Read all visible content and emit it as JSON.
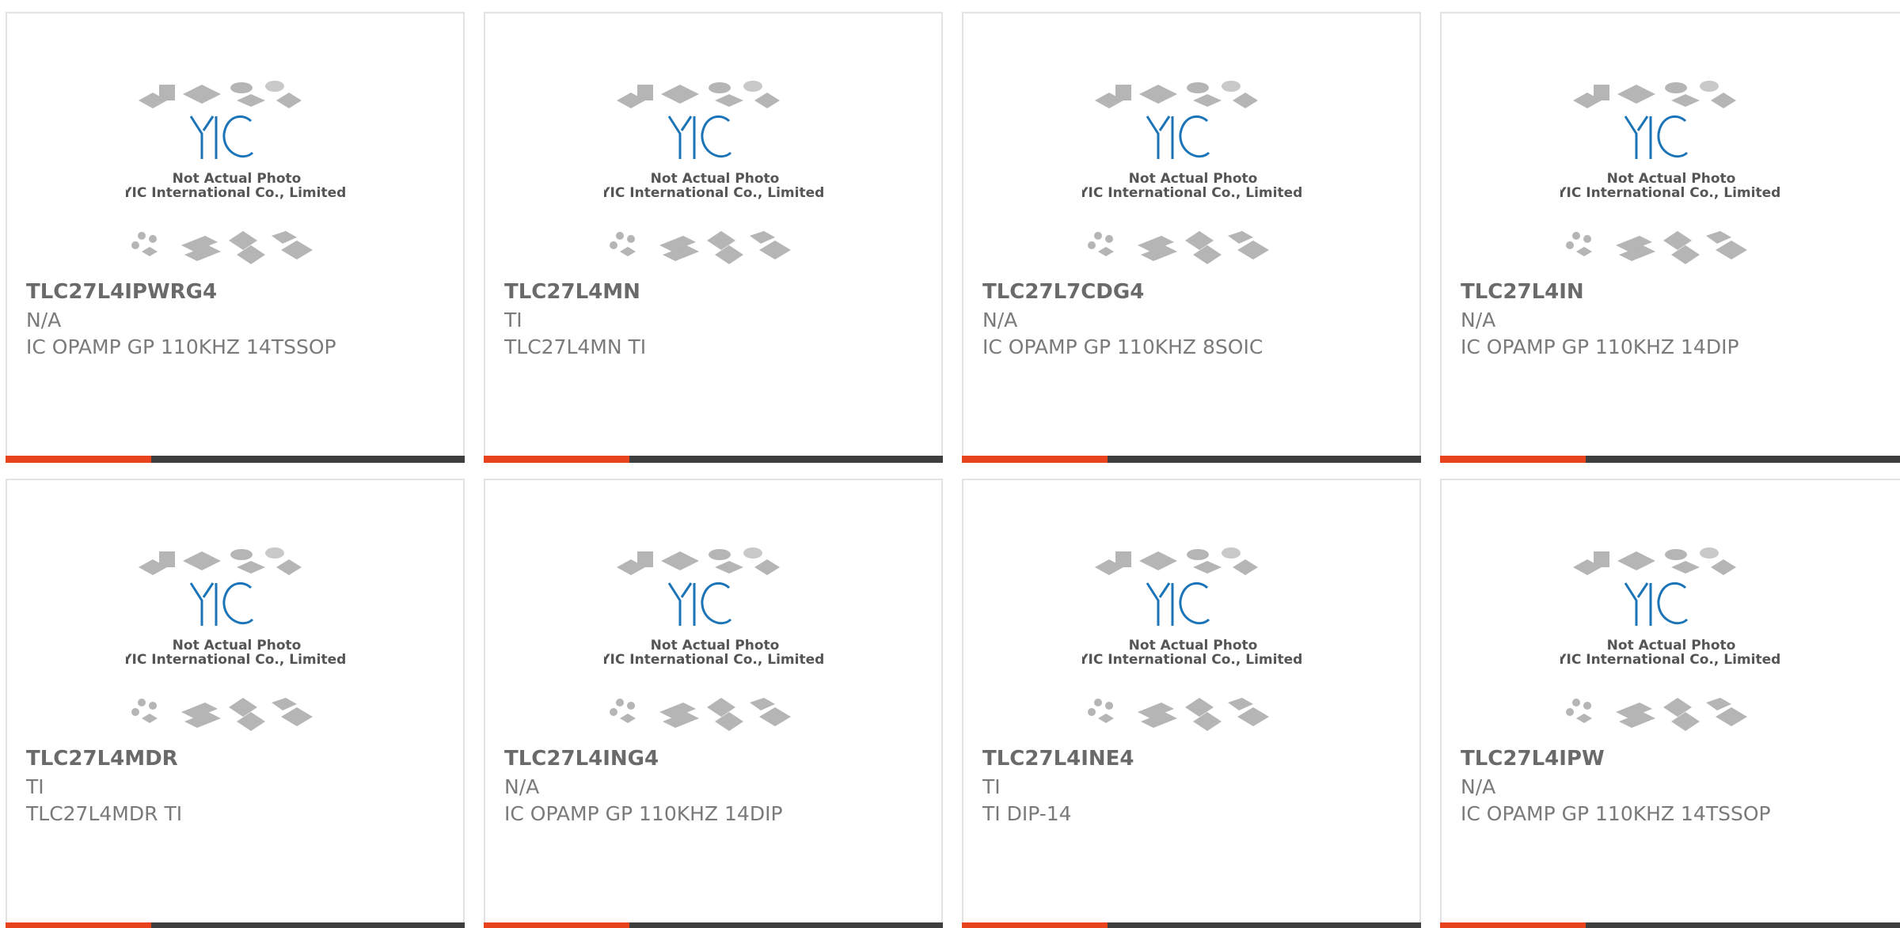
{
  "placeholder": {
    "line1": "Not Actual Photo",
    "line2": "YIC International Co., Limited.",
    "logo_text": "YIC"
  },
  "colors": {
    "accent": "#e8431c",
    "bar": "#3e3e3e",
    "logo": "#1b74b8"
  },
  "products": [
    {
      "part": "TLC27L4IPWRG4",
      "manufacturer": "N/A",
      "description": "IC OPAMP GP 110KHZ 14TSSOP"
    },
    {
      "part": "TLC27L4MN",
      "manufacturer": "TI",
      "description": "TLC27L4MN TI"
    },
    {
      "part": "TLC27L7CDG4",
      "manufacturer": "N/A",
      "description": "IC OPAMP GP 110KHZ 8SOIC"
    },
    {
      "part": "TLC27L4IN",
      "manufacturer": "N/A",
      "description": "IC OPAMP GP 110KHZ 14DIP"
    },
    {
      "part": "TLC27L4MDR",
      "manufacturer": "TI",
      "description": "TLC27L4MDR TI"
    },
    {
      "part": "TLC27L4ING4",
      "manufacturer": "N/A",
      "description": "IC OPAMP GP 110KHZ 14DIP"
    },
    {
      "part": "TLC27L4INE4",
      "manufacturer": "TI",
      "description": "TI DIP-14"
    },
    {
      "part": "TLC27L4IPW",
      "manufacturer": "N/A",
      "description": "IC OPAMP GP 110KHZ 14TSSOP"
    }
  ]
}
